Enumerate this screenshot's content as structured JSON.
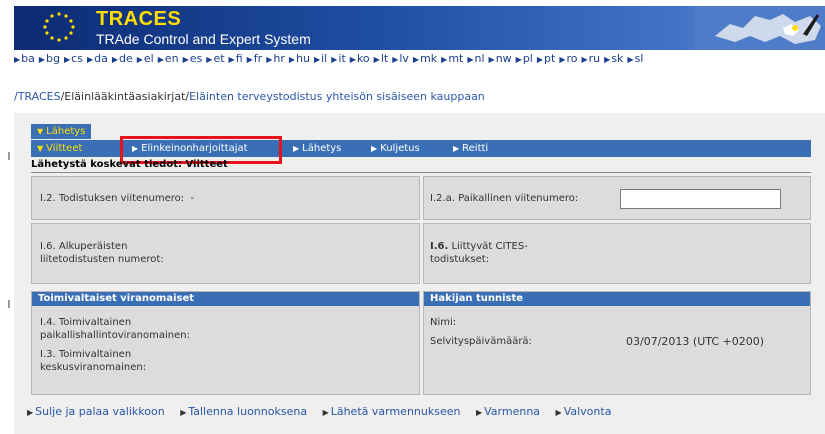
{
  "header": {
    "title": "TRACES",
    "subtitle": "TRAde Control and Expert System"
  },
  "languages": [
    "ba",
    "bg",
    "cs",
    "da",
    "de",
    "el",
    "en",
    "es",
    "et",
    "fi",
    "fr",
    "hr",
    "hu",
    "il",
    "it",
    "ko",
    "lt",
    "lv",
    "mk",
    "mt",
    "nl",
    "nw",
    "pl",
    "pt",
    "ro",
    "ru",
    "sk",
    "sl"
  ],
  "breadcrumb": {
    "root": "/TRACES",
    "sep1": "/",
    "level1": "Eläinlääkintäasiakirjat",
    "sep2": "/",
    "current": "Eläinten terveystodistus yhteisön sisäiseen kauppaan"
  },
  "tabs": {
    "row1": "Lähetys",
    "items": [
      "Viitteet",
      "Elinkeinonharjoittajat",
      "Lähetys",
      "Kuljetus",
      "Reitti"
    ]
  },
  "section_title": "Lähetystä koskevat tiedot: Viitteet",
  "fields": {
    "cert_ref_label": "I.2. Todistuksen viitenumero:",
    "cert_ref_value": "-",
    "local_ref_label": "I.2.a. Paikallinen viitenumero:",
    "local_ref_value": "",
    "orig_cert_label_1": "I.6. Alkuperäisten",
    "orig_cert_label_2": "liitetodistusten numerot:",
    "cites_label_prefix": "I.6.",
    "cites_label_1": " Liittyvät CITES-",
    "cites_label_2": "todistukset:"
  },
  "authorities": {
    "heading": "Toimivaltaiset viranomaiset",
    "local_label_1": "I.4. Toimivaltainen",
    "local_label_2": "paikallishallintoviranomainen:",
    "central_label_1": "I.3. Toimivaltainen",
    "central_label_2": "keskusviranomainen:"
  },
  "applicant": {
    "heading": "Hakijan tunniste",
    "name_label": "Nimi:",
    "date_label": "Selvityspäivämäärä:",
    "date_value": "03/07/2013 (UTC +0200)"
  },
  "actions": [
    "Sulje ja palaa valikkoon",
    "Tallenna luonnoksena",
    "Lähetä varmennukseen",
    "Varmenna",
    "Valvonta"
  ],
  "colors": {
    "header_blue": "#1f4fa3",
    "title_yellow": "#ffde00",
    "tab_blue": "#3a6fb5",
    "highlight_red": "#e8121b",
    "link_blue": "#2a56a8"
  }
}
